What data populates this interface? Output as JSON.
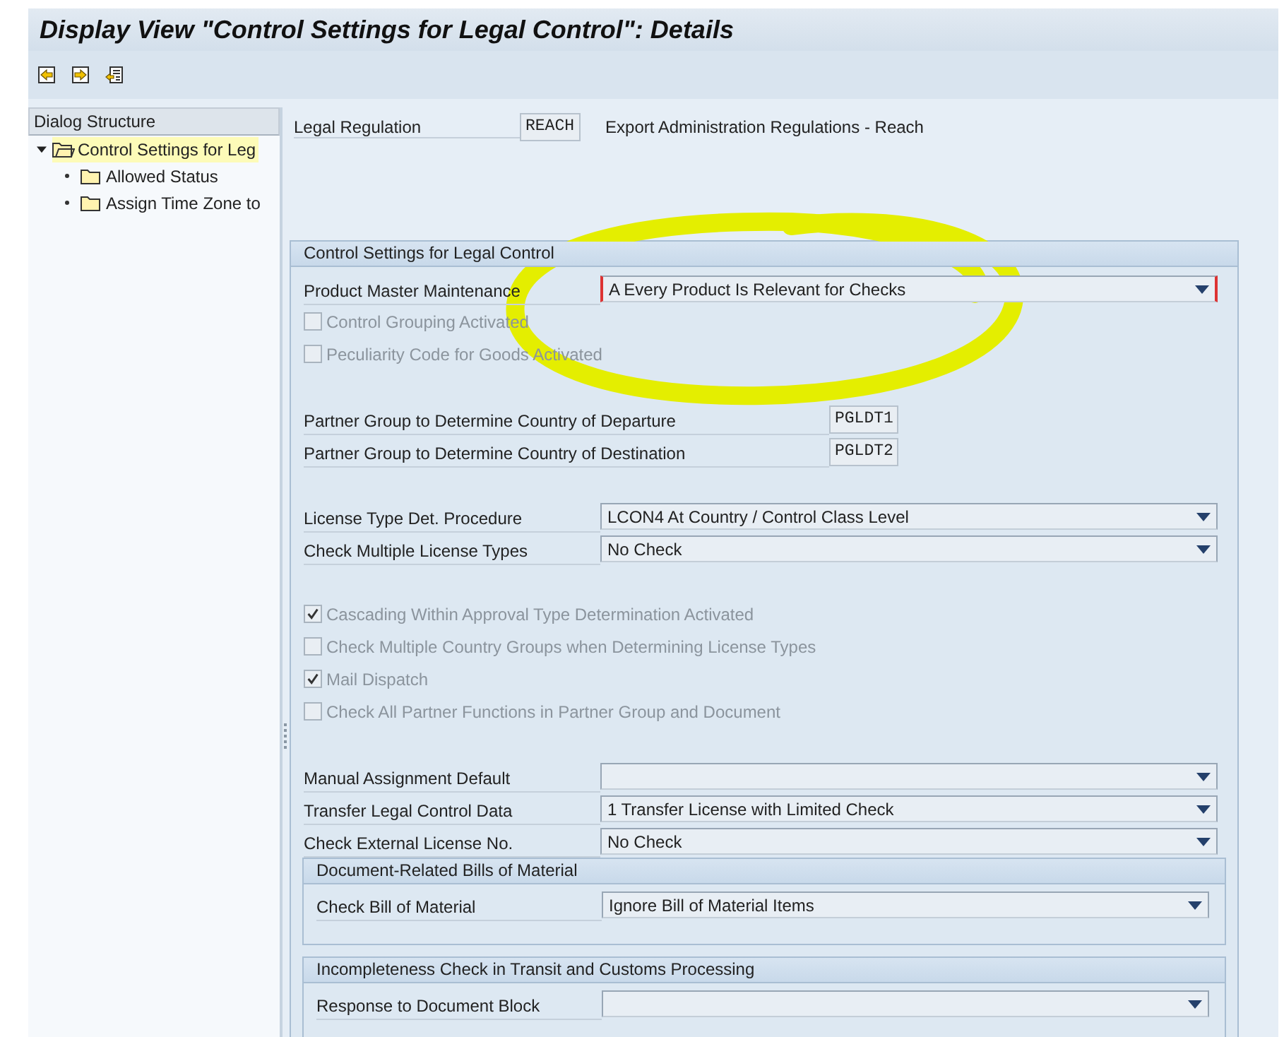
{
  "window": {
    "title": "Display View \"Control Settings for Legal Control\": Details"
  },
  "dialog_structure": {
    "title": "Dialog Structure",
    "items": [
      {
        "label": "Control Settings for Leg",
        "expanded": true,
        "selected": true,
        "children": [
          {
            "label": "Allowed Status",
            "selected": false
          },
          {
            "label": "Assign Time Zone to",
            "selected": false
          }
        ]
      }
    ]
  },
  "header": {
    "label": "Legal Regulation",
    "value": "REACH",
    "description": "Export Administration Regulations - Reach"
  },
  "group": {
    "title": "Control Settings for Legal Control",
    "blocks": [
      [
        {
          "kind": "dropdown",
          "label": "Product Master Maintenance",
          "value": "A Every Product Is Relevant for Checks",
          "required": true
        },
        {
          "kind": "checkbox",
          "label": "Control Grouping Activated",
          "checked": false,
          "disabled": true
        },
        {
          "kind": "checkbox",
          "label": "Peculiarity Code for Goods Activated",
          "checked": false,
          "disabled": true
        }
      ],
      [
        {
          "kind": "short_field",
          "label": "Partner Group to Determine Country of Departure",
          "value": "PGLDT1"
        },
        {
          "kind": "short_field",
          "label": "Partner Group to Determine Country of Destination",
          "value": "PGLDT2"
        }
      ],
      [
        {
          "kind": "dropdown",
          "label": "License Type Det. Procedure",
          "value": "LCON4 At Country / Control Class Level",
          "required": false
        },
        {
          "kind": "dropdown",
          "label": "Check Multiple License Types",
          "value": "No Check",
          "required": false
        }
      ],
      [
        {
          "kind": "checkbox",
          "label": "Cascading Within Approval Type Determination Activated",
          "checked": true,
          "disabled": true
        },
        {
          "kind": "checkbox",
          "label": "Check Multiple Country Groups when Determining License Types",
          "checked": false,
          "disabled": true
        },
        {
          "kind": "checkbox",
          "label": "Mail Dispatch",
          "checked": true,
          "disabled": true
        },
        {
          "kind": "checkbox",
          "label": "Check All Partner Functions in Partner Group and Document",
          "checked": false,
          "disabled": true
        }
      ],
      [
        {
          "kind": "dropdown",
          "label": "Manual Assignment Default",
          "required": false
        },
        {
          "kind": "dropdown",
          "label": "Transfer Legal Control Data",
          "value": "1 Transfer License with Limited Check",
          "required": false
        },
        {
          "kind": "dropdown",
          "label": "Check External License No.",
          "value": "No Check",
          "required": false
        }
      ]
    ],
    "subgroups": [
      {
        "title": "Document-Related Bills of Material",
        "rows": [
          {
            "kind": "dropdown",
            "label": "Check Bill of Material",
            "value": "Ignore Bill of Material Items",
            "required": false
          }
        ]
      },
      {
        "title": "Incompleteness Check in Transit and Customs Processing",
        "rows": [
          {
            "kind": "dropdown",
            "label": "Response to Document Block",
            "required": false
          }
        ]
      }
    ]
  },
  "annotation": {
    "kind": "highlight_circle",
    "color": "#e4ee00"
  }
}
